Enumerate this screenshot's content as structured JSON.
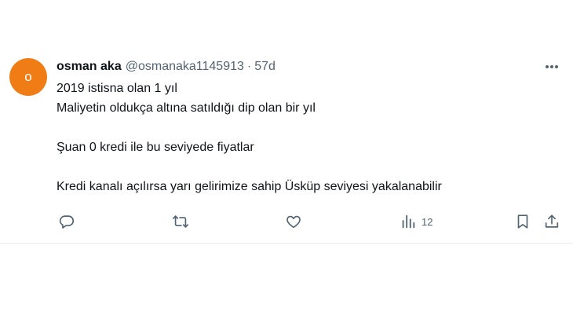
{
  "tweet": {
    "author": {
      "avatar_letter": "o",
      "avatar_color": "#f07c16",
      "display_name": "osman aka",
      "handle": "@osmanaka1145913",
      "separator": "·",
      "time": "57d"
    },
    "text": {
      "line1": "2019 istisna olan 1 yıl",
      "line2": "Maliyetin oldukça altına satıldığı dip olan bir yıl",
      "line3": "Şuan 0 kredi ile bu seviyede fiyatlar",
      "line4": "Kredi kanalı açılırsa yarı gelirimize sahip Üsküp seviyesi yakalanabilir"
    },
    "actions": {
      "reply_icon": "reply-icon",
      "retweet_icon": "retweet-icon",
      "like_icon": "heart-icon",
      "views_icon": "views-icon",
      "views_count": "12",
      "bookmark_icon": "bookmark-icon",
      "share_icon": "share-icon"
    },
    "menu_icon": "more-icon",
    "colors": {
      "text": "#0f1419",
      "secondary": "#536471",
      "divider": "#e6ecf0"
    }
  }
}
